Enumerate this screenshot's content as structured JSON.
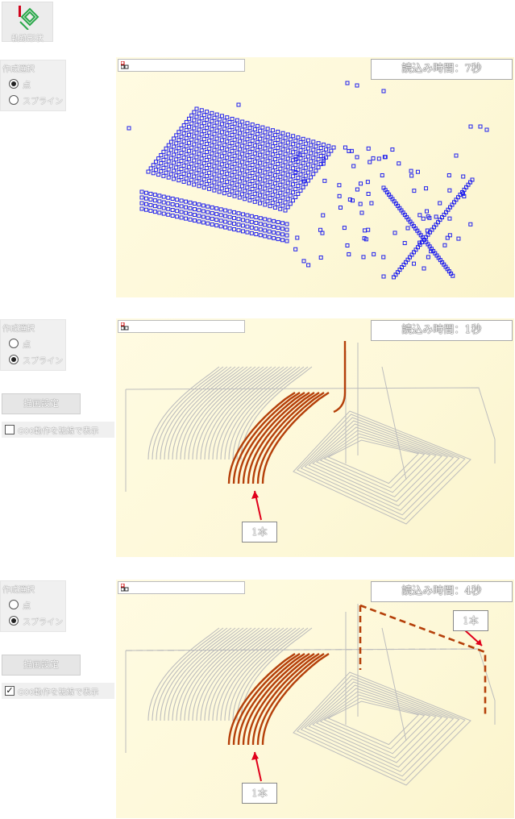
{
  "toolbar": {
    "button_label": "軌跡形状",
    "button_icon": "track-shape-icon"
  },
  "panels": [
    {
      "group_title": "作成選択",
      "radio_point": "点",
      "radio_spline": "スプライン",
      "selected": "point",
      "read_time": "読込み時間：7秒"
    },
    {
      "group_title": "作成選択",
      "radio_point": "点",
      "radio_spline": "スプライン",
      "selected": "spline",
      "draw_settings": "描画設定",
      "g00_label": "G00動作を破線で表示",
      "g00_checked": false,
      "read_time": "読込み時間：1秒",
      "callout": "1本"
    },
    {
      "group_title": "作成選択",
      "radio_point": "点",
      "radio_spline": "スプライン",
      "selected": "spline",
      "draw_settings": "描画設定",
      "g00_label": "G00動作を破線で表示",
      "g00_checked": true,
      "read_time": "読込み時間：4秒",
      "callout_a": "1本",
      "callout_b": "1本"
    }
  ],
  "colors": {
    "points": "#2020ee",
    "highlight": "#b5400a",
    "path": "#bdbdbd",
    "arrow": "#e0001b"
  }
}
